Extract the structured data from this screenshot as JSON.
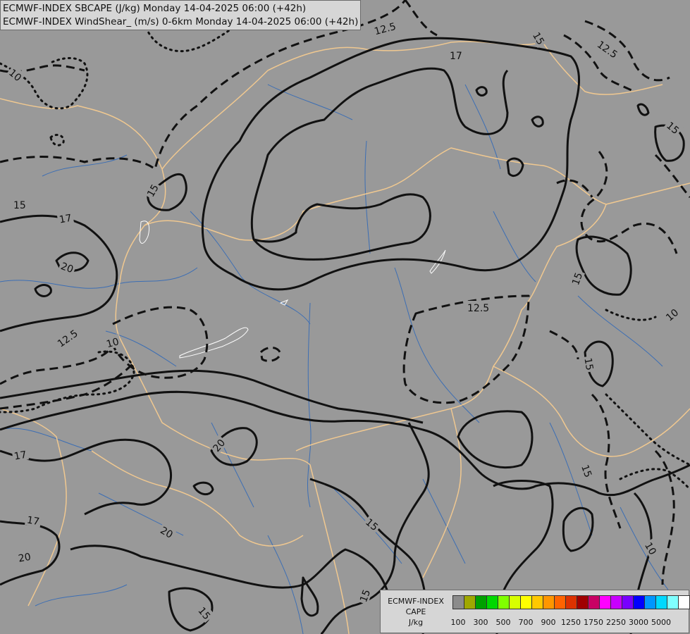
{
  "header": {
    "line1": "ECMWF-INDEX SBCAPE (J/kg) Monday 14-04-2025 06:00 (+42h)",
    "line2": "ECMWF-INDEX WindShear_ (m/s) 0-6km Monday 14-04-2025 06:00 (+42h)"
  },
  "legend": {
    "title_line1": "ECMWF-INDEX",
    "title_line2": "CAPE",
    "title_line3": "J/kg",
    "swatch_colors": [
      "#8c8c8c",
      "#a0a800",
      "#00a000",
      "#00d800",
      "#80ff00",
      "#d8ff00",
      "#ffff00",
      "#ffc800",
      "#ff9600",
      "#ff6400",
      "#dc3200",
      "#a00000",
      "#c80064",
      "#ff00ff",
      "#c800ff",
      "#7800ff",
      "#0000ff",
      "#0096ff",
      "#00d8ff",
      "#80ffff",
      "#ffffff"
    ],
    "tick_labels": [
      "100",
      "300",
      "500",
      "700",
      "900",
      "1250",
      "1750",
      "2250",
      "3000",
      "5000"
    ]
  },
  "contour_labels": [
    "12.5",
    "17",
    "15",
    "12.5",
    "15",
    "10",
    "15",
    "17",
    "15",
    "20",
    "12.5",
    "15",
    "10",
    "12.5",
    "10",
    "15",
    "17",
    "20",
    "17",
    "20",
    "15",
    "20",
    "15",
    "15",
    "10",
    "15"
  ],
  "colors": {
    "background": "#999999",
    "contour": "#111111",
    "borders": "#f0c890",
    "rivers": "#3c6eb4",
    "lakes_outline": "#ffffff"
  }
}
